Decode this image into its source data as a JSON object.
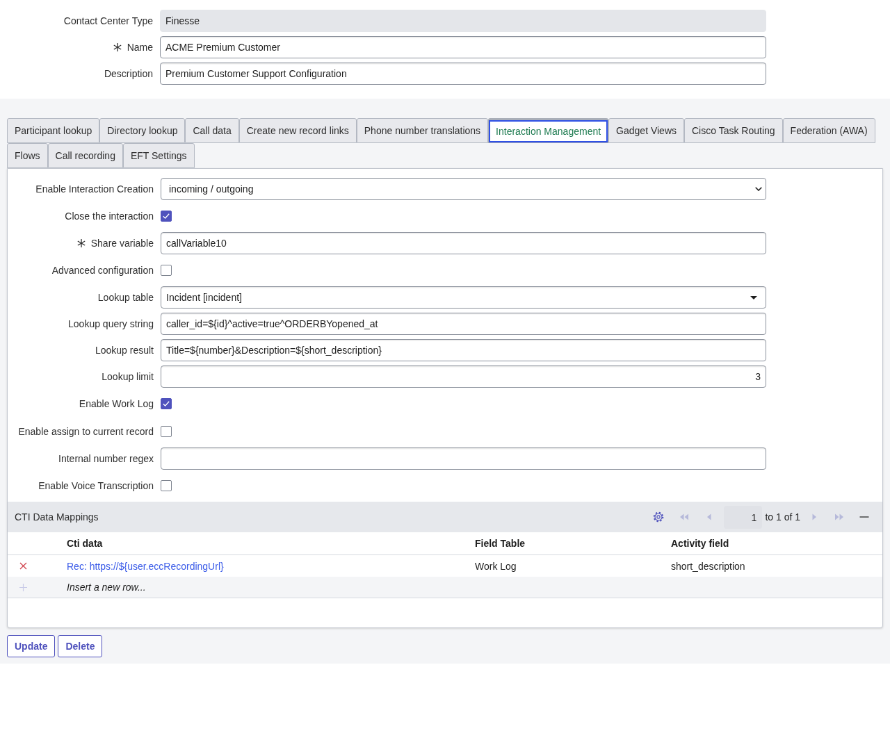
{
  "header_fields": [
    {
      "label": "Contact Center Type",
      "kind": "readonly",
      "value": "Finesse",
      "required": false
    },
    {
      "label": "Name",
      "kind": "text",
      "value": "ACME Premium Customer",
      "required": true
    },
    {
      "label": "Description",
      "kind": "text",
      "value": "Premium Customer Support Configuration",
      "required": false
    }
  ],
  "tabs": [
    {
      "label": "Participant lookup",
      "selected": false
    },
    {
      "label": "Directory lookup",
      "selected": false
    },
    {
      "label": "Call data",
      "selected": false
    },
    {
      "label": "Create new record links",
      "selected": false
    },
    {
      "label": "Phone number translations",
      "selected": false
    },
    {
      "label": "Interaction Management",
      "selected": true
    },
    {
      "label": "Gadget Views",
      "selected": false
    },
    {
      "label": "Cisco Task Routing",
      "selected": false
    },
    {
      "label": "Federation (AWA)",
      "selected": false
    },
    {
      "label": "Flows",
      "selected": false
    },
    {
      "label": "Call recording",
      "selected": false
    },
    {
      "label": "EFT Settings",
      "selected": false
    }
  ],
  "form_fields": [
    {
      "label": "Enable Interaction Creation",
      "kind": "select",
      "value": "incoming / outgoing",
      "required": false
    },
    {
      "label": "Close the interaction",
      "kind": "checkbox",
      "checked": true,
      "required": false
    },
    {
      "label": "Share variable",
      "kind": "text",
      "value": "callVariable10",
      "required": true
    },
    {
      "label": "Advanced configuration",
      "kind": "checkbox",
      "checked": false,
      "required": false
    },
    {
      "label": "Lookup table",
      "kind": "reference",
      "value": "Incident [incident]",
      "required": false
    },
    {
      "label": "Lookup query string",
      "kind": "text",
      "value": "caller_id=${id}^active=true^ORDERBYopened_at",
      "required": false
    },
    {
      "label": "Lookup result",
      "kind": "text",
      "value": "Title=${number}&Description=${short_description}",
      "required": false
    },
    {
      "label": "Lookup limit",
      "kind": "number",
      "value": "3",
      "required": false
    },
    {
      "label": "Enable Work Log",
      "kind": "checkbox",
      "checked": true,
      "required": false
    },
    {
      "label": "Enable assign to current record",
      "kind": "checkbox",
      "checked": false,
      "required": false
    },
    {
      "label": "Internal number regex",
      "kind": "text",
      "required": false
    },
    {
      "label": "Enable Voice Transcription",
      "kind": "checkbox",
      "checked": false,
      "required": false
    }
  ],
  "related_list": {
    "title": "CTI Data Mappings",
    "pagination": {
      "page": "1",
      "summary": "to 1 of 1",
      "buttons": [
        {
          "kind": "first",
          "disabled": true
        },
        {
          "kind": "previous",
          "disabled": true
        },
        {
          "kind": "next",
          "disabled": true
        },
        {
          "kind": "last",
          "disabled": true
        }
      ]
    },
    "columns": [
      "Cti data",
      "Field Table",
      "Activity field"
    ],
    "rows": [
      {
        "cells": [
          "Rec: https://${user.eccRecordingUrl}",
          "Work Log",
          "short_description"
        ]
      }
    ],
    "insert_row": "Insert a new row..."
  },
  "buttons": [
    "Update",
    "Delete"
  ]
}
